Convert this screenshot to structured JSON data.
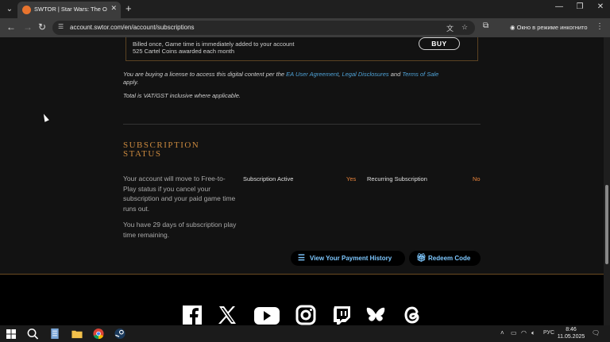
{
  "browser": {
    "tab_title": "SWTOR | Star Wars: The Old Re",
    "url": "account.swtor.com/en/account/subscriptions",
    "incognito_label": "Окно в режиме инкогнито"
  },
  "purchase": {
    "billed_line1": "Billed once, Game time is immediately added to your account",
    "billed_line2": "525 Cartel Coins awarded each month",
    "buy_label": "BUY"
  },
  "license": {
    "prefix": "You are buying a license to access this digital content per the ",
    "link1": "EA User Agreement",
    "sep1": ", ",
    "link2": "Legal Disclosures",
    "sep2": " and ",
    "link3": "Terms of Sale",
    "suffix": "apply.",
    "vat": "Total is VAT/GST inclusive where applicable."
  },
  "subscription": {
    "title_line1": "SUBSCRIPTION",
    "title_line2": "STATUS",
    "description": "Your account will move to Free-to-Play status if you cancel your subscription and your paid game time runs out.",
    "remaining": "You have 29 days of subscription play time remaining.",
    "active_label": "Subscription Active",
    "active_value": "Yes",
    "recurring_label": "Recurring Subscription",
    "recurring_value": "No",
    "payment_history_label": "View Your Payment History",
    "redeem_label": "Redeem Code"
  },
  "taskbar": {
    "lang": "РУС",
    "time": "8:46",
    "date": "11.05.2025"
  }
}
